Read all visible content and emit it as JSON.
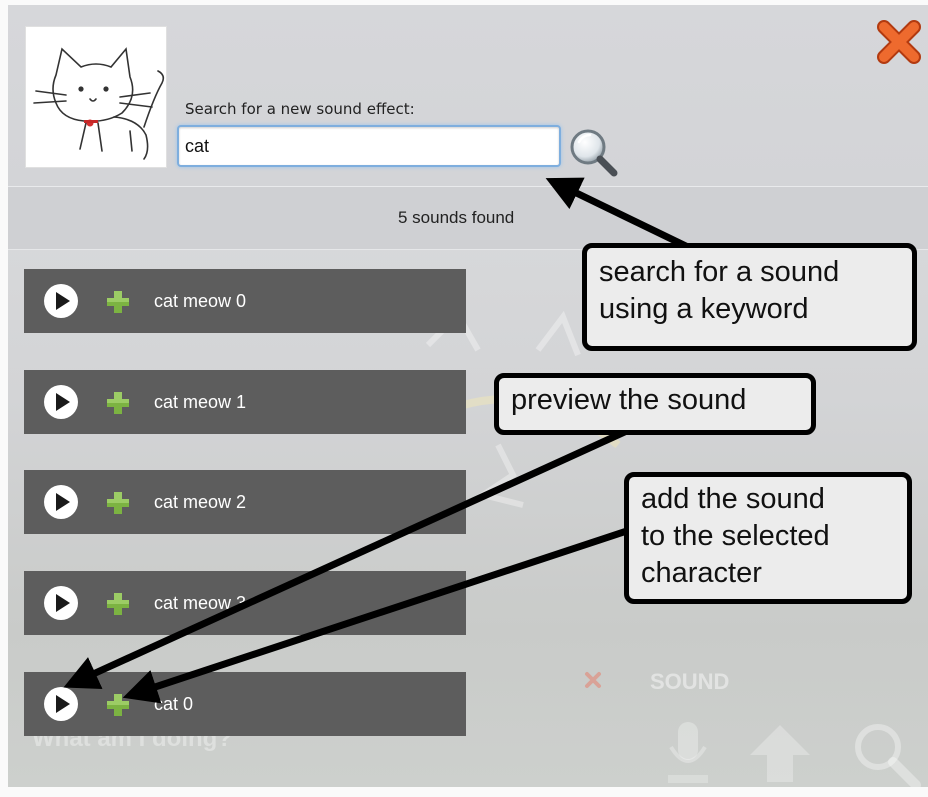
{
  "dialog": {
    "search_label": "Search for a new sound effect:",
    "search_value": "cat",
    "results_count": "5 sounds found",
    "icons": {
      "close": "close-x-icon",
      "search": "magnifier-icon",
      "thumbnail": "cat-character-thumbnail"
    }
  },
  "sounds": [
    {
      "label": "cat meow 0",
      "preview_icon": "play-icon",
      "add_icon": "plus-icon"
    },
    {
      "label": "cat meow 1",
      "preview_icon": "play-icon",
      "add_icon": "plus-icon"
    },
    {
      "label": "cat meow 2",
      "preview_icon": "play-icon",
      "add_icon": "plus-icon"
    },
    {
      "label": "cat meow 3",
      "preview_icon": "play-icon",
      "add_icon": "plus-icon"
    },
    {
      "label": "cat 0",
      "preview_icon": "play-icon",
      "add_icon": "plus-icon"
    }
  ],
  "background": {
    "sound_tab_label": "SOUND",
    "status_text": "What am I doing?"
  },
  "annotations": {
    "search": [
      "search for a sound",
      "using a keyword"
    ],
    "preview": [
      "preview the sound"
    ],
    "add": [
      "add the sound",
      "to the selected",
      "character"
    ]
  },
  "colors": {
    "row_bg": "#5d5d5d",
    "plus_green": "#7cb342",
    "close_orange": "#e8541c",
    "input_focus": "#7eaede"
  }
}
